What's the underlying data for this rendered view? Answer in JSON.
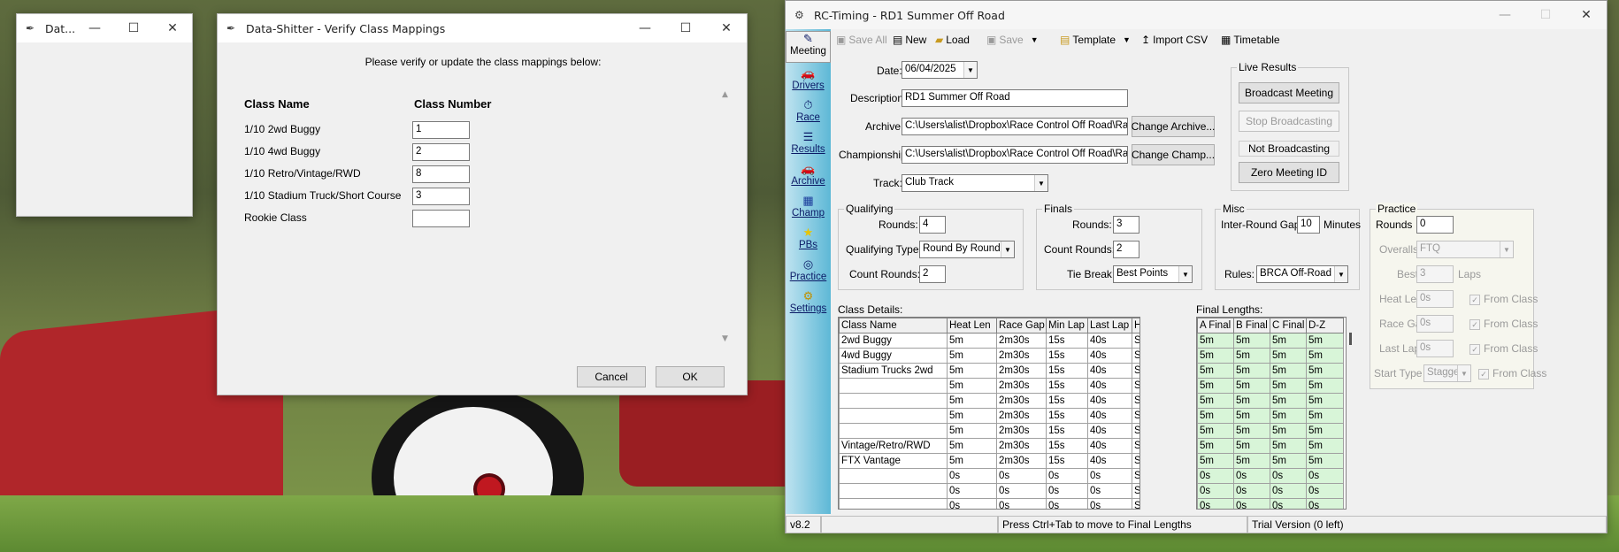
{
  "small_window": {
    "title": "Dat..."
  },
  "dialog": {
    "title": "Data-Shitter - Verify Class Mappings",
    "instruction": "Please verify or update the class mappings below:",
    "col_name": "Class Name",
    "col_number": "Class Number",
    "rows": [
      {
        "name": "1/10 2wd Buggy",
        "number": "1"
      },
      {
        "name": "1/10 4wd Buggy",
        "number": "2"
      },
      {
        "name": "1/10 Retro/Vintage/RWD",
        "number": "8"
      },
      {
        "name": "1/10 Stadium Truck/Short Course",
        "number": "3"
      },
      {
        "name": "Rookie Class",
        "number": ""
      }
    ],
    "cancel": "Cancel",
    "ok": "OK"
  },
  "app": {
    "title": "RC-Timing - RD1 Summer Off Road",
    "nav": [
      {
        "label": "Meeting",
        "icon": "meeting-icon",
        "glyph": "✎"
      },
      {
        "label": "Drivers",
        "icon": "drivers-icon",
        "glyph": "🚗"
      },
      {
        "label": "Race",
        "icon": "race-icon",
        "glyph": "⏱"
      },
      {
        "label": "Results",
        "icon": "results-icon",
        "glyph": "☰"
      },
      {
        "label": "Archive",
        "icon": "archive-icon",
        "glyph": "🚗"
      },
      {
        "label": "Champ",
        "icon": "champ-icon",
        "glyph": "▦"
      },
      {
        "label": "PBs",
        "icon": "pbs-icon",
        "glyph": "★"
      },
      {
        "label": "Practice",
        "icon": "practice-icon",
        "glyph": "◎"
      },
      {
        "label": "Settings",
        "icon": "settings-icon",
        "glyph": "⚙"
      }
    ],
    "toolbar": {
      "save_all": "Save All",
      "new": "New",
      "load": "Load",
      "save": "Save",
      "template": "Template",
      "import_csv": "Import CSV",
      "timetable": "Timetable"
    },
    "meeting": {
      "date_label": "Date:",
      "date": "06/04/2025",
      "description_label": "Description:",
      "description": "RD1 Summer Off Road",
      "archive_label": "Archive:",
      "archive": "C:\\Users\\alist\\Dropbox\\Race Control Off Road\\Rac",
      "change_archive": "Change Archive...",
      "championship_label": "Championship:",
      "championship": "C:\\Users\\alist\\Dropbox\\Race Control Off Road\\Rac",
      "change_champ": "Change Champ...",
      "track_label": "Track:",
      "track": "Club Track"
    },
    "live": {
      "title": "Live Results",
      "broadcast": "Broadcast Meeting",
      "stop": "Stop Broadcasting",
      "status": "Not Broadcasting",
      "zero": "Zero Meeting ID"
    },
    "qualifying": {
      "title": "Qualifying",
      "rounds_label": "Rounds:",
      "rounds": "4",
      "type_label": "Qualifying Type:",
      "type": "Round By Round",
      "count_label": "Count Rounds:",
      "count": "2"
    },
    "finals": {
      "title": "Finals",
      "rounds_label": "Rounds:",
      "rounds": "3",
      "count_label": "Count Rounds:",
      "count": "2",
      "tie_label": "Tie Break:",
      "tie": "Best Points"
    },
    "misc": {
      "title": "Misc",
      "gap_label": "Inter-Round Gap:",
      "gap": "10",
      "gap_unit": "Minutes",
      "rules_label": "Rules:",
      "rules": "BRCA Off-Road"
    },
    "practice": {
      "title": "Practice",
      "rounds_label": "Rounds",
      "rounds": "0",
      "overalls_label": "Overalls",
      "overalls": "FTQ",
      "best_label": "Best",
      "best": "3",
      "best_unit": "Laps",
      "heat_label": "Heat Len",
      "heat": "0s",
      "gap_label": "Race Gap",
      "gap": "0s",
      "last_label": "Last Lap",
      "last": "0s",
      "start_label": "Start Type",
      "start": "Stagger",
      "from_class": "From Class"
    },
    "class_details_label": "Class Details:",
    "class_headers": [
      "Class Name",
      "Heat Len",
      "Race Gap",
      "Min Lap",
      "Last Lap",
      "Heat Start"
    ],
    "class_rows": [
      [
        "2wd Buggy",
        "5m",
        "2m30s",
        "15s",
        "40s",
        "Stagger"
      ],
      [
        "4wd Buggy",
        "5m",
        "2m30s",
        "15s",
        "40s",
        "Stagger"
      ],
      [
        "Stadium Trucks 2wd",
        "5m",
        "2m30s",
        "15s",
        "40s",
        "Stagger"
      ],
      [
        "",
        "5m",
        "2m30s",
        "15s",
        "40s",
        "Stagger"
      ],
      [
        "",
        "5m",
        "2m30s",
        "15s",
        "40s",
        "Stagger"
      ],
      [
        "",
        "5m",
        "2m30s",
        "15s",
        "40s",
        "Stagger"
      ],
      [
        "",
        "5m",
        "2m30s",
        "15s",
        "40s",
        "Stagger"
      ],
      [
        "Vintage/Retro/RWD",
        "5m",
        "2m30s",
        "15s",
        "40s",
        "Stagger"
      ],
      [
        "FTX Vantage",
        "5m",
        "2m30s",
        "15s",
        "40s",
        "Stagger"
      ],
      [
        "",
        "0s",
        "0s",
        "0s",
        "0s",
        "Stagger"
      ],
      [
        "",
        "0s",
        "0s",
        "0s",
        "0s",
        "Stagger"
      ],
      [
        "",
        "0s",
        "0s",
        "0s",
        "0s",
        "Stagger"
      ]
    ],
    "final_lengths_label": "Final Lengths:",
    "final_headers": [
      "A Final",
      "B Final",
      "C Final",
      "D-Z"
    ],
    "final_rows": [
      [
        "5m",
        "5m",
        "5m",
        "5m"
      ],
      [
        "5m",
        "5m",
        "5m",
        "5m"
      ],
      [
        "5m",
        "5m",
        "5m",
        "5m"
      ],
      [
        "5m",
        "5m",
        "5m",
        "5m"
      ],
      [
        "5m",
        "5m",
        "5m",
        "5m"
      ],
      [
        "5m",
        "5m",
        "5m",
        "5m"
      ],
      [
        "5m",
        "5m",
        "5m",
        "5m"
      ],
      [
        "5m",
        "5m",
        "5m",
        "5m"
      ],
      [
        "5m",
        "5m",
        "5m",
        "5m"
      ],
      [
        "0s",
        "0s",
        "0s",
        "0s"
      ],
      [
        "0s",
        "0s",
        "0s",
        "0s"
      ],
      [
        "0s",
        "0s",
        "0s",
        "0s"
      ]
    ],
    "status": {
      "version": "v8.2",
      "hint": "Press Ctrl+Tab to move to Final Lengths",
      "trial": "Trial Version (0 left)"
    }
  }
}
